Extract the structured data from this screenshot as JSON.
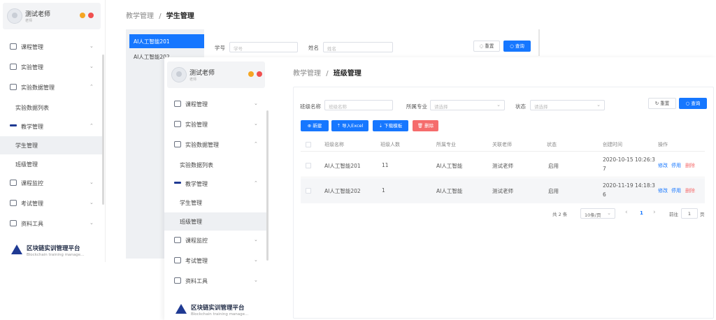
{
  "colors": {
    "primary": "#1677ff",
    "danger": "#f56c6c",
    "navy": "#1f3a93"
  },
  "back_sidebar": {
    "user_name": "测试老师",
    "user_role": "老师",
    "menu": [
      {
        "label": "课程管理",
        "icon": "book-icon",
        "chevron": "⌄"
      },
      {
        "label": "实验管理",
        "icon": "monitor-icon",
        "chevron": "⌄"
      },
      {
        "label": "实验数据管理",
        "icon": "database-icon",
        "chevron": "⌃"
      },
      {
        "label": "实验数据列表",
        "sub": true
      },
      {
        "label": "教学管理",
        "icon": "teaching-icon",
        "chevron": "⌃"
      },
      {
        "label": "学生管理",
        "sub": true,
        "active": true
      },
      {
        "label": "班级管理",
        "sub": true
      },
      {
        "label": "课程监控",
        "icon": "monitoring-icon",
        "chevron": "⌄"
      },
      {
        "label": "考试管理",
        "icon": "exam-icon",
        "chevron": "⌄"
      },
      {
        "label": "资料工具",
        "icon": "toolbox-icon",
        "chevron": "⌄"
      }
    ],
    "brand_title": "区块链实训管理平台",
    "brand_sub": "Blockchain training manage..."
  },
  "back_page": {
    "breadcrumb_parent": "教学管理",
    "breadcrumb_sep": "/",
    "breadcrumb_current": "学生管理",
    "class_list": [
      "AI人工智能201",
      "AI人工智能202"
    ],
    "filter_student_no_label": "学号",
    "filter_student_no_placeholder": "学号",
    "filter_name_label": "姓名",
    "filter_name_placeholder": "姓名",
    "reset_label": "重置",
    "search_label": "查询"
  },
  "front_sidebar": {
    "user_name": "测试老师",
    "user_role": "老师",
    "menu": [
      {
        "label": "课程管理",
        "icon": "book-icon",
        "chevron": "⌄"
      },
      {
        "label": "实验管理",
        "icon": "monitor-icon",
        "chevron": "⌄"
      },
      {
        "label": "实验数据管理",
        "icon": "database-icon",
        "chevron": "⌃"
      },
      {
        "label": "实验数据列表",
        "sub": true
      },
      {
        "label": "教学管理",
        "icon": "teaching-icon",
        "chevron": "⌃"
      },
      {
        "label": "学生管理",
        "sub": true
      },
      {
        "label": "班级管理",
        "sub": true,
        "active": true
      },
      {
        "label": "课程监控",
        "icon": "monitoring-icon",
        "chevron": "⌄"
      },
      {
        "label": "考试管理",
        "icon": "exam-icon",
        "chevron": "⌄"
      },
      {
        "label": "资料工具",
        "icon": "toolbox-icon",
        "chevron": "⌄"
      }
    ],
    "brand_title": "区块链实训管理平台",
    "brand_sub": "Blockchain training manage..."
  },
  "front_page": {
    "breadcrumb_parent": "教学管理",
    "breadcrumb_sep": "/",
    "breadcrumb_current": "班级管理",
    "filters": {
      "class_name_label": "班级名称",
      "class_name_placeholder": "班级名称",
      "major_label": "所属专业",
      "major_placeholder": "请选择",
      "status_label": "状态",
      "status_placeholder": "请选择",
      "reset_label": "重置",
      "search_label": "查询"
    },
    "actions": {
      "create": "新建",
      "import_excel": "导入Excel",
      "download_template": "下载模板",
      "delete": "删除"
    },
    "table": {
      "headers": [
        "班级名称",
        "班级人数",
        "所属专业",
        "关联老师",
        "状态",
        "创建时间",
        "操作"
      ],
      "rows": [
        {
          "name": "AI人工智能201",
          "count": "11",
          "major": "AI人工智能",
          "teacher": "测试老师",
          "status": "启用",
          "created_line1": "2020-10-15 10:26:3",
          "created_line2": "7",
          "op_edit": "修改",
          "op_toggle": "停用",
          "op_delete": "删除"
        },
        {
          "name": "AI人工智能202",
          "count": "1",
          "major": "AI人工智能",
          "teacher": "测试老师",
          "status": "启用",
          "created_line1": "2020-11-19 14:18:3",
          "created_line2": "6",
          "op_edit": "修改",
          "op_toggle": "停用",
          "op_delete": "删除"
        }
      ]
    },
    "pagination": {
      "total": "共 2 条",
      "page_size": "10条/页",
      "prev": "‹",
      "current_page": "1",
      "next": "›",
      "goto_label": "前往",
      "goto_value": "1",
      "page_suffix": "页"
    }
  }
}
